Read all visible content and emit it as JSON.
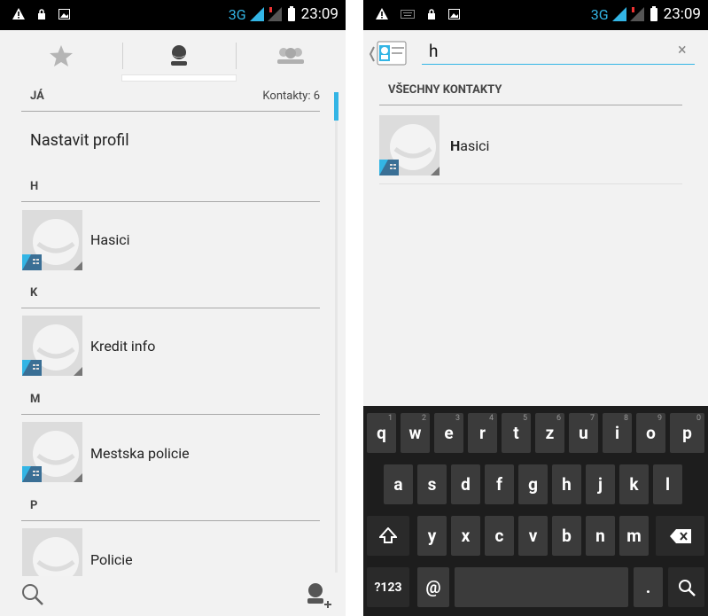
{
  "status": {
    "network": "3G",
    "time": "23:09"
  },
  "left": {
    "me_header": "JÁ",
    "contacts_count": "Kontakty: 6",
    "set_profile": "Nastavit profil",
    "sections": [
      {
        "letter": "H",
        "contact": "Hasici"
      },
      {
        "letter": "K",
        "contact": "Kredit info"
      },
      {
        "letter": "M",
        "contact": "Mestska policie"
      },
      {
        "letter": "P",
        "contact": "Policie"
      }
    ]
  },
  "right": {
    "search_value": "h",
    "clear_icon": "×",
    "section_title": "VŠECHNY KONTAKTY",
    "result_highlight": "H",
    "result_rest": "asici"
  },
  "keyboard": {
    "row1": [
      {
        "k": "q",
        "h": "1"
      },
      {
        "k": "w",
        "h": "2"
      },
      {
        "k": "e",
        "h": "3"
      },
      {
        "k": "r",
        "h": "4"
      },
      {
        "k": "t",
        "h": "5"
      },
      {
        "k": "z",
        "h": "6"
      },
      {
        "k": "u",
        "h": "7"
      },
      {
        "k": "i",
        "h": "8"
      },
      {
        "k": "o",
        "h": "9"
      },
      {
        "k": "p",
        "h": "0"
      }
    ],
    "row2": [
      "a",
      "s",
      "d",
      "f",
      "g",
      "h",
      "j",
      "k",
      "l"
    ],
    "row3": [
      "y",
      "x",
      "c",
      "v",
      "b",
      "n",
      "m"
    ],
    "symbols": "?123",
    "at": "@",
    "period": "."
  }
}
